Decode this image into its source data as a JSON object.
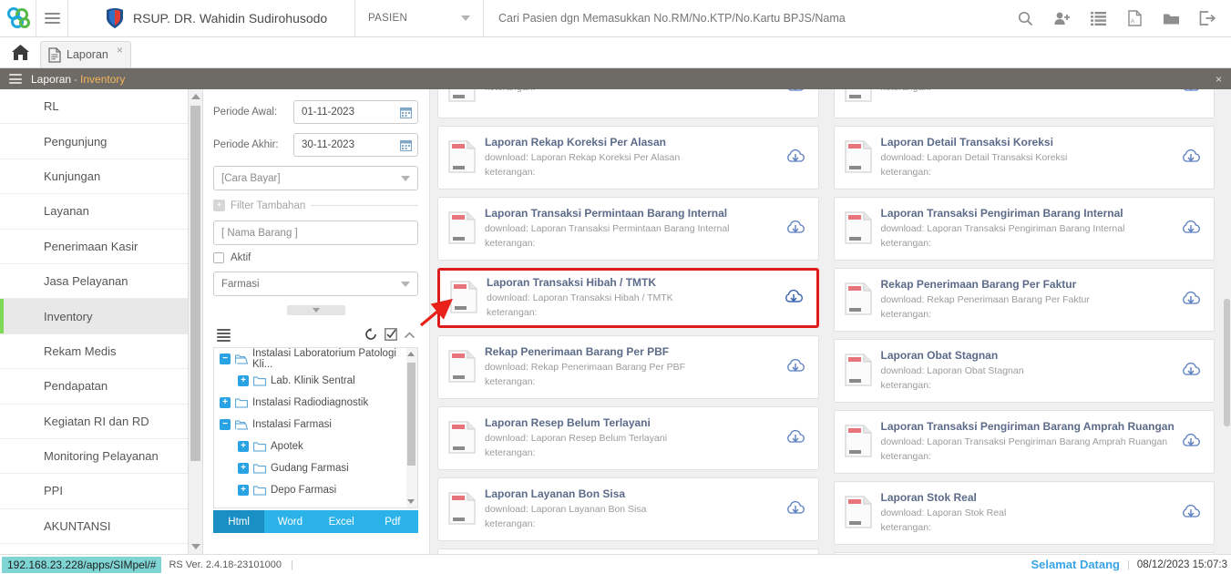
{
  "header": {
    "logo_icon": "simpel-logo-icon",
    "menu_icon": "hamburger-icon",
    "hospital_icon": "hospital-shield-icon",
    "hospital_name": "RSUP. DR. Wahidin Sudirohusodo",
    "context_select": "PASIEN",
    "search_placeholder": "Cari Pasien dgn Memasukkan No.RM/No.KTP/No.Kartu BPJS/Nama",
    "search_value": "",
    "icons": [
      {
        "name": "search-icon",
        "glyph": "search"
      },
      {
        "name": "add-user-icon",
        "glyph": "user-plus"
      },
      {
        "name": "list-icon",
        "glyph": "list"
      },
      {
        "name": "pdf-icon",
        "glyph": "pdf"
      },
      {
        "name": "folder-icon",
        "glyph": "folder"
      },
      {
        "name": "logout-icon",
        "glyph": "logout"
      }
    ],
    "color_strip": [
      "#a95bbd",
      "#2f9bd8",
      "#5cb82f",
      "#f2b721",
      "#ee8022",
      "#d83a2c"
    ]
  },
  "tabs": {
    "home_icon": "home-icon",
    "items": [
      {
        "label": "Laporan",
        "icon": "document-icon",
        "close": "×",
        "active": true
      }
    ]
  },
  "breadcrumb": {
    "menu_icon": "hamburger-icon",
    "root": "Laporan",
    "separator": "-",
    "current": "Inventory",
    "close": "×"
  },
  "sidebar": {
    "items": [
      {
        "label": "RL",
        "active": false
      },
      {
        "label": "Pengunjung",
        "active": false
      },
      {
        "label": "Kunjungan",
        "active": false
      },
      {
        "label": "Layanan",
        "active": false
      },
      {
        "label": "Penerimaan Kasir",
        "active": false
      },
      {
        "label": "Jasa Pelayanan",
        "active": false
      },
      {
        "label": "Inventory",
        "active": true
      },
      {
        "label": "Rekam Medis",
        "active": false
      },
      {
        "label": "Pendapatan",
        "active": false
      },
      {
        "label": "Kegiatan RI dan RD",
        "active": false
      },
      {
        "label": "Monitoring Pelayanan",
        "active": false
      },
      {
        "label": "PPI",
        "active": false
      },
      {
        "label": "AKUNTANSI",
        "active": false
      }
    ]
  },
  "filters": {
    "periode_awal_label": "Periode Awal:",
    "periode_awal_value": "01-11-2023",
    "periode_akhir_label": "Periode Akhir:",
    "periode_akhir_value": "30-11-2023",
    "calendar_icon": "calendar-icon",
    "cara_bayar": "[Cara Bayar]",
    "filter_tambahan_label": "Filter Tambahan",
    "filter_tambahan_icon": "plus-box-icon",
    "nama_barang_placeholder": "[ Nama Barang ]",
    "nama_barang_value": "",
    "aktif_label": "Aktif",
    "aktif_checked": false,
    "unit_value": "Farmasi",
    "tree_toolbar": {
      "list_icon": "list-view-icon",
      "reset_icon": "refresh-icon",
      "checkall_icon": "check-box-icon",
      "collapse_icon": "chevron-up-icon"
    },
    "tree": [
      {
        "label": "Instalasi Laboratorium Patologi Kli...",
        "level": 0,
        "expanded": true
      },
      {
        "label": "Lab. Klinik Sentral",
        "level": 1,
        "expanded": false
      },
      {
        "label": "Instalasi Radiodiagnostik",
        "level": 0,
        "expanded": false
      },
      {
        "label": "Instalasi Farmasi",
        "level": 0,
        "expanded": true
      },
      {
        "label": "Apotek",
        "level": 1,
        "expanded": false
      },
      {
        "label": "Gudang Farmasi",
        "level": 1,
        "expanded": false
      },
      {
        "label": "Depo Farmasi",
        "level": 1,
        "expanded": false
      }
    ],
    "export_buttons": [
      {
        "label": "Html",
        "active": true
      },
      {
        "label": "Word",
        "active": false
      },
      {
        "label": "Excel",
        "active": false
      },
      {
        "label": "Pdf",
        "active": false
      }
    ]
  },
  "reports": {
    "download_prefix": "download: ",
    "keterangan_label": "keterangan:",
    "doc_icon": "report-document-icon",
    "download_icon": "cloud-download-icon",
    "highlight_color": "#e01b1b",
    "left_column": [
      {
        "title": "",
        "partial": true
      },
      {
        "title": "Laporan Rekap Koreksi Per Alasan",
        "highlight": false
      },
      {
        "title": "Laporan Transaksi Permintaan Barang Internal",
        "highlight": false
      },
      {
        "title": "Laporan Transaksi Hibah / TMTK",
        "highlight": true
      },
      {
        "title": "Rekap Penerimaan Barang Per PBF",
        "highlight": false
      },
      {
        "title": "Laporan Resep Belum Terlayani",
        "highlight": false
      },
      {
        "title": "Laporan Layanan Bon Sisa",
        "highlight": false
      }
    ],
    "right_column": [
      {
        "title": "",
        "partial": true
      },
      {
        "title": "Laporan Detail Transaksi Koreksi",
        "highlight": false
      },
      {
        "title": "Laporan Transaksi Pengiriman Barang Internal",
        "highlight": false
      },
      {
        "title": "Rekap Penerimaan Barang Per Faktur",
        "highlight": false
      },
      {
        "title": "Laporan Obat Stagnan",
        "highlight": false
      },
      {
        "title": "Laporan Transaksi Pengiriman Barang Amprah Ruangan",
        "highlight": false
      },
      {
        "title": "Laporan Stok Real",
        "highlight": false
      }
    ]
  },
  "footer": {
    "url": "192.168.23.228/apps/SIMpel/#",
    "version": "RS Ver. 2.4.18-23101000",
    "welcome": "Selamat Datang",
    "timestamp": "08/12/2023 15:07:3"
  }
}
